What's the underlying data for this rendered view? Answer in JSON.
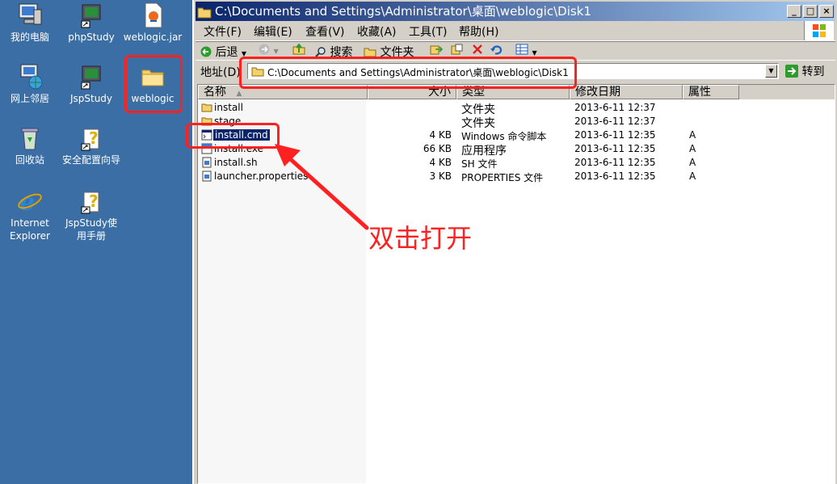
{
  "desktop": {
    "icons": [
      {
        "label": "我的电脑",
        "icon": "my-computer-icon"
      },
      {
        "label": "phpStudy",
        "icon": "shortcut-icon"
      },
      {
        "label": "weblogic.jar",
        "icon": "jar-file-icon"
      },
      {
        "label": "网上邻居",
        "icon": "network-icon"
      },
      {
        "label": "JspStudy",
        "icon": "shortcut-icon"
      },
      {
        "label": "weblogic",
        "icon": "folder-icon"
      },
      {
        "label": "回收站",
        "icon": "recycle-bin-icon"
      },
      {
        "label": "安全配置向导",
        "icon": "help-shortcut-icon"
      },
      {
        "label": "Internet Explorer",
        "icon": "ie-icon"
      },
      {
        "label": "JspStudy使用手册",
        "icon": "help-shortcut-icon"
      }
    ]
  },
  "window": {
    "title": "C:\\Documents and Settings\\Administrator\\桌面\\weblogic\\Disk1",
    "controls": {
      "minimize": "_",
      "maximize": "□",
      "close": "×"
    }
  },
  "menubar": {
    "items": [
      "文件(F)",
      "编辑(E)",
      "查看(V)",
      "收藏(A)",
      "工具(T)",
      "帮助(H)"
    ]
  },
  "toolbar": {
    "back": "后退",
    "search": "搜索",
    "folders": "文件夹"
  },
  "address": {
    "label": "地址(D)",
    "value": "C:\\Documents and Settings\\Administrator\\桌面\\weblogic\\Disk1",
    "go": "转到"
  },
  "columns": [
    "名称",
    "大小",
    "类型",
    "修改日期",
    "属性"
  ],
  "files": [
    {
      "name": "install",
      "size": "",
      "type": "文件夹",
      "date": "2013-6-11 12:37",
      "attr": "",
      "icon": "folder-icon"
    },
    {
      "name": "stage",
      "size": "",
      "type": "文件夹",
      "date": "2013-6-11 12:37",
      "attr": "",
      "icon": "folder-icon"
    },
    {
      "name": "install.cmd",
      "size": "4 KB",
      "type": "Windows 命令脚本",
      "date": "2013-6-11 12:35",
      "attr": "A",
      "icon": "cmd-file-icon"
    },
    {
      "name": "install.exe",
      "size": "66 KB",
      "type": "应用程序",
      "date": "2013-6-11 12:35",
      "attr": "A",
      "icon": "exe-file-icon"
    },
    {
      "name": "install.sh",
      "size": "4 KB",
      "type": "SH 文件",
      "date": "2013-6-11 12:35",
      "attr": "A",
      "icon": "text-file-icon"
    },
    {
      "name": "launcher.properties",
      "size": "3 KB",
      "type": "PROPERTIES 文件",
      "date": "2013-6-11 12:35",
      "attr": "A",
      "icon": "text-file-icon"
    }
  ],
  "annotation": {
    "text": "双击打开",
    "color": "#ff2020"
  },
  "colors": {
    "desktop": "#3a6ea5",
    "titlebar": "#0a246a",
    "selection": "#0a246a"
  }
}
